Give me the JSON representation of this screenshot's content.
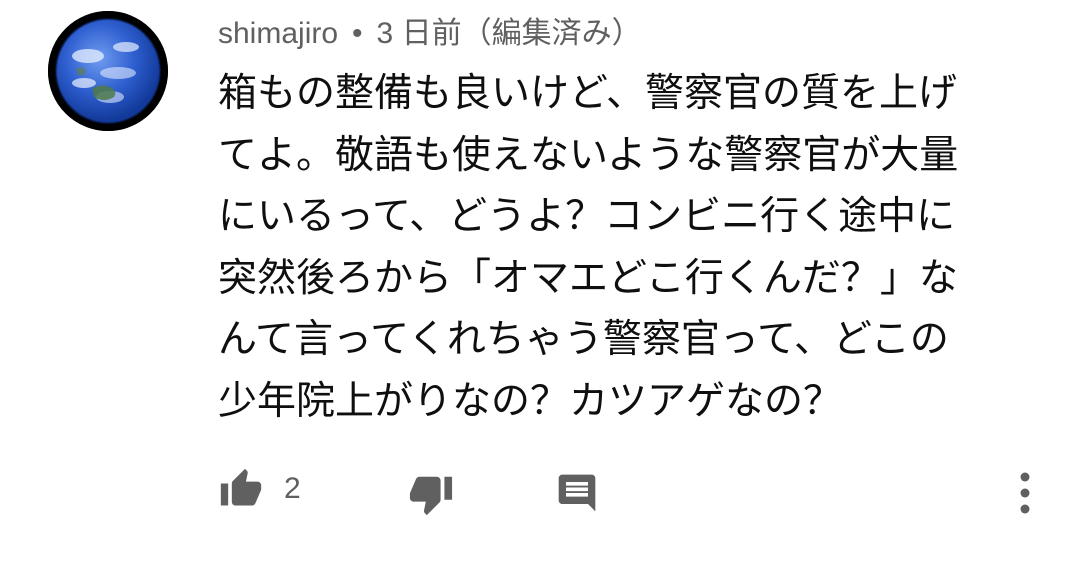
{
  "comment": {
    "author": "shimajiro",
    "separator": "•",
    "timestamp": "3 日前（編集済み）",
    "body_lines": [
      "箱もの整備も良いけど、警察官の質を上げ",
      "てよ。敬語も使えないような警察官が大量",
      "にいるって、どうよ？コンビニ行く途中に",
      "突然後ろから「オマエどこ行くんだ？」な",
      "んて言ってくれちゃう警察官って、どこの",
      "少年院上がりなの？カツアゲなの？"
    ]
  },
  "actions": {
    "like_count": "2",
    "like_icon": "thumb-up-icon",
    "dislike_icon": "thumb-down-icon",
    "reply_icon": "comment-reply-icon",
    "more_icon": "more-vert-icon"
  },
  "colors": {
    "icon": "#606060",
    "meta_text": "#606060",
    "body_text": "#0f0f0f",
    "avatar_ocean": "#2f5fd0"
  }
}
